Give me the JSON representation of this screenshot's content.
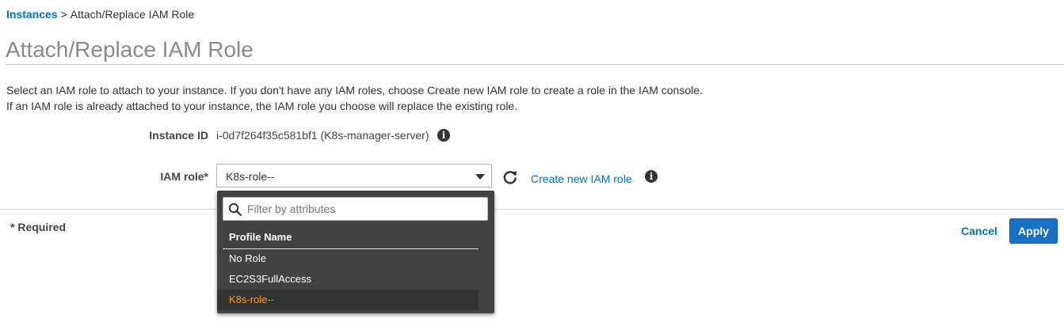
{
  "breadcrumb": {
    "root": "Instances",
    "separator": ">",
    "current": "Attach/Replace IAM Role"
  },
  "page": {
    "title": "Attach/Replace IAM Role"
  },
  "description": {
    "line1": "Select an IAM role to attach to your instance. If you don't have any IAM roles, choose Create new IAM role to create a role in the IAM console.",
    "line2": "If an IAM role is already attached to your instance, the IAM role you choose will replace the existing role."
  },
  "instance": {
    "label": "Instance ID",
    "value": "i-0d7f264f35c581bf1 (K8s-manager-server)"
  },
  "iam_role": {
    "label": "IAM role*",
    "selected": "K8s-role--",
    "create_link": "Create new IAM role"
  },
  "dropdown": {
    "filter_placeholder": "Filter by attributes",
    "column_header": "Profile Name",
    "options": [
      "No Role",
      "EC2S3FullAccess",
      "K8s-role--"
    ],
    "selected_option": "K8s-role--"
  },
  "footer": {
    "required_note": "* Required",
    "cancel_label": "Cancel",
    "apply_label": "Apply"
  },
  "icons": {
    "info": "info-icon",
    "refresh": "refresh-icon",
    "caret": "chevron-down-icon",
    "search": "search-icon"
  },
  "colors": {
    "link": "#0073bb",
    "primary_button": "#1a6fc6",
    "dropdown_bg": "#424242",
    "selected_option": "#ff9900"
  }
}
